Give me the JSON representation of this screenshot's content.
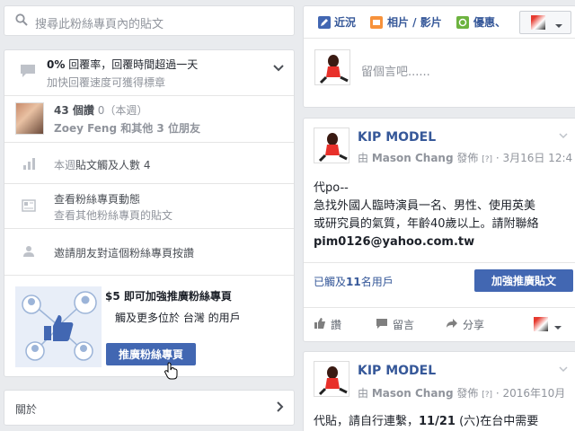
{
  "search": {
    "placeholder": "搜尋此粉絲專頁內的貼文"
  },
  "info": {
    "response": {
      "rate": "0%",
      "rate_text": " 回覆率，回覆時間超過一天",
      "sub": "加快回覆速度可獲得標章"
    },
    "likes": {
      "count": "43 個讚",
      "zero": " 0",
      "paren_open": "（",
      "new": "本週",
      "paren_close": "）",
      "names": "Zoey Feng 和其他 3 位朋友"
    },
    "reach": {
      "prefix": "本週",
      "text": "貼文觸及人數 4"
    },
    "activity": {
      "title": "查看粉絲專頁動態",
      "sub": "查看其他粉絲專頁的貼文"
    },
    "invite": {
      "text": "邀請朋友對這個粉絲專頁按讚"
    }
  },
  "promo": {
    "price": "$5 即可加強推廣粉絲專頁",
    "desc_prefix": "觸及更多位於 ",
    "desc_place": "台灣",
    "desc_suffix": " 的用戶",
    "button": "推廣粉絲專頁"
  },
  "about": {
    "label": "關於"
  },
  "composer": {
    "tabs": [
      {
        "label": "近況"
      },
      {
        "label": "相片 / 影片"
      },
      {
        "label": "優惠、"
      }
    ],
    "placeholder": "留個言吧......"
  },
  "posts": [
    {
      "author": "KIP MODEL",
      "by": "由 ",
      "poster": "Mason Chang",
      "published": " 發佈 ",
      "help": "[?]",
      "date": " · 3月16日 12:4",
      "lines": [
        "代po--",
        "急找外國人臨時演員一名、男性、使用英美",
        "或研究員的氣質，年齡40歲以上。請附聯絡",
        "pim0126@yahoo.com.tw"
      ],
      "reach_prefix": "已觸及",
      "reach_count": "11",
      "reach_suffix": "名用戶",
      "boost_button": "加強推廣貼文",
      "actions": {
        "like": "讚",
        "comment": "留言",
        "share": "分享"
      }
    },
    {
      "author": "KIP MODEL",
      "by": "由 ",
      "poster": "Mason Chang",
      "published": " 發佈 ",
      "help": "[?]",
      "date": " · 2016年10月",
      "text_prefix": "代貼，請自行連繫，",
      "text_bold": "11/21",
      "text_suffix": " (六)在台中需要"
    }
  ],
  "colors": {
    "accent": "#4267b2",
    "link": "#365899",
    "background": "#e9ebee",
    "secondary_text": "#90949c"
  },
  "icons": [
    "search-icon",
    "chat-bubble-icon",
    "chevron-down-icon",
    "bar-chart-icon",
    "news-feed-icon",
    "invite-icon",
    "thumbs-up-icon",
    "chevron-right-icon",
    "pencil-icon",
    "photo-icon",
    "offer-icon",
    "speaker-icon",
    "hand-cursor-icon",
    "comment-icon",
    "share-icon"
  ]
}
